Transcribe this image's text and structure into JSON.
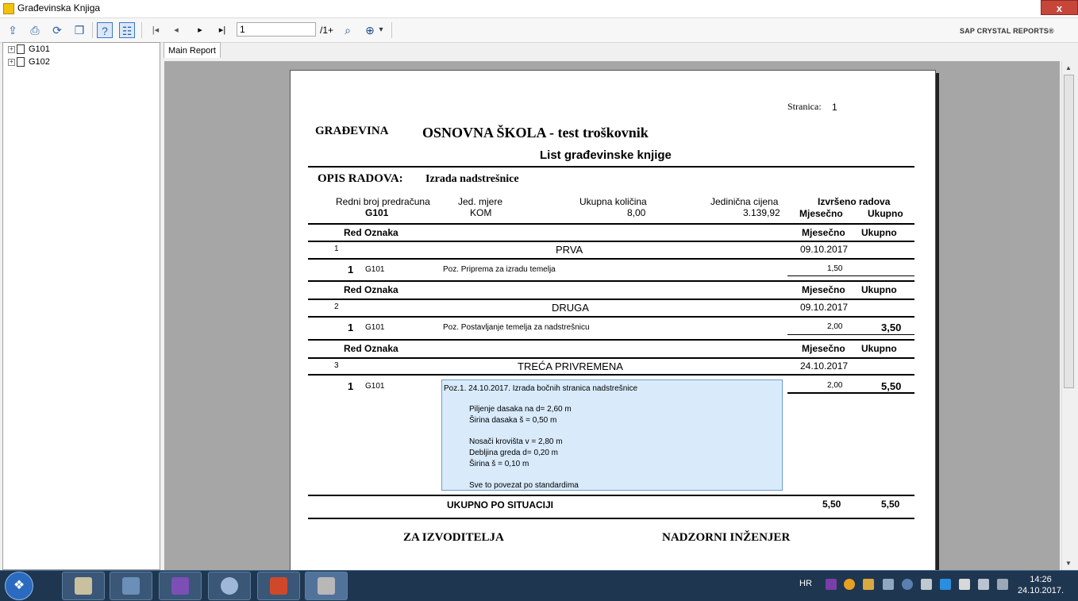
{
  "window": {
    "title": "Građevinska Knjiga",
    "close_label": "x"
  },
  "toolbar": {
    "page_value": "1",
    "page_count": "/1+",
    "brand": "SAP CRYSTAL REPORTS®",
    "zoom_caret": "▾"
  },
  "tree": {
    "items": [
      {
        "label": "G101"
      },
      {
        "label": "G102"
      }
    ]
  },
  "tab": {
    "label": "Main Report"
  },
  "report": {
    "stranica_label": "Stranica:",
    "stranica_value": "1",
    "gradevina_label": "GRAĐEVINA",
    "project_title": "OSNOVNA ŠKOLA - test troškovnik",
    "list_title": "List građevinske knjige",
    "opis_label": "OPIS RADOVA:",
    "opis_value": "Izrada nadstrešnice",
    "hdr": {
      "redni_broj": "Redni broj predračuna",
      "redni_broj_val": "G101",
      "jed_mjere": "Jed. mjere",
      "jed_mjere_val": "KOM",
      "ukupna_kolicina": "Ukupna količina",
      "ukupna_kolicina_val": "8,00",
      "jedinicna_cijena": "Jedinična cijena",
      "jedinicna_cijena_val": "3.139,92",
      "izvrseno": "Izvršeno radova",
      "mjesecno": "Mjesečno",
      "ukupno": "Ukupno"
    },
    "group_hdr": {
      "red_oznaka": "Red Oznaka",
      "mjesecno": "Mjesečno",
      "ukupno": "Ukupno"
    },
    "groups": [
      {
        "num": "1",
        "name": "PRVA",
        "date": "09.10.2017",
        "row_num": "1",
        "code": "G101",
        "desc": "Poz. Priprema za izradu temelja",
        "mjesecno": "1,50",
        "ukupno": ""
      },
      {
        "num": "2",
        "name": "DRUGA",
        "date": "09.10.2017",
        "row_num": "1",
        "code": "G101",
        "desc": "Poz. Postavljanje temelja za nadstrešnicu",
        "mjesecno": "2,00",
        "ukupno": "3,50"
      },
      {
        "num": "3",
        "name": "TREĆA PRIVREMENA",
        "date": "24.10.2017",
        "row_num": "1",
        "code": "G101",
        "desc": "",
        "mjesecno": "2,00",
        "ukupno": "5,50"
      }
    ],
    "detail_lines": [
      "Poz.1. 24.10.2017.  Izrada bočnih stranica nadstrešnice",
      "Piljenje dasaka na d= 2,60 m",
      "Širina dasaka      š = 0,50 m",
      "Nosači krovišta    v = 2,80 m",
      "Debljina greda    d= 0,20 m",
      "Širina                š = 0,10 m",
      "Sve to povezat po standardima"
    ],
    "ukupno_label": "UKUPNO PO SITUACIJI",
    "ukupno_mjesecno": "5,50",
    "ukupno_ukupno": "5,50",
    "sign_left": "ZA IZVODITELJA",
    "sign_right": "NADZORNI INŽENJER"
  },
  "taskbar": {
    "lang": "HR",
    "time": "14:26",
    "date": "24.10.2017."
  },
  "colors": {
    "accent": "#2b5fa8",
    "highlight_box": "#d9ebfb",
    "taskbar": "#1f3650"
  }
}
